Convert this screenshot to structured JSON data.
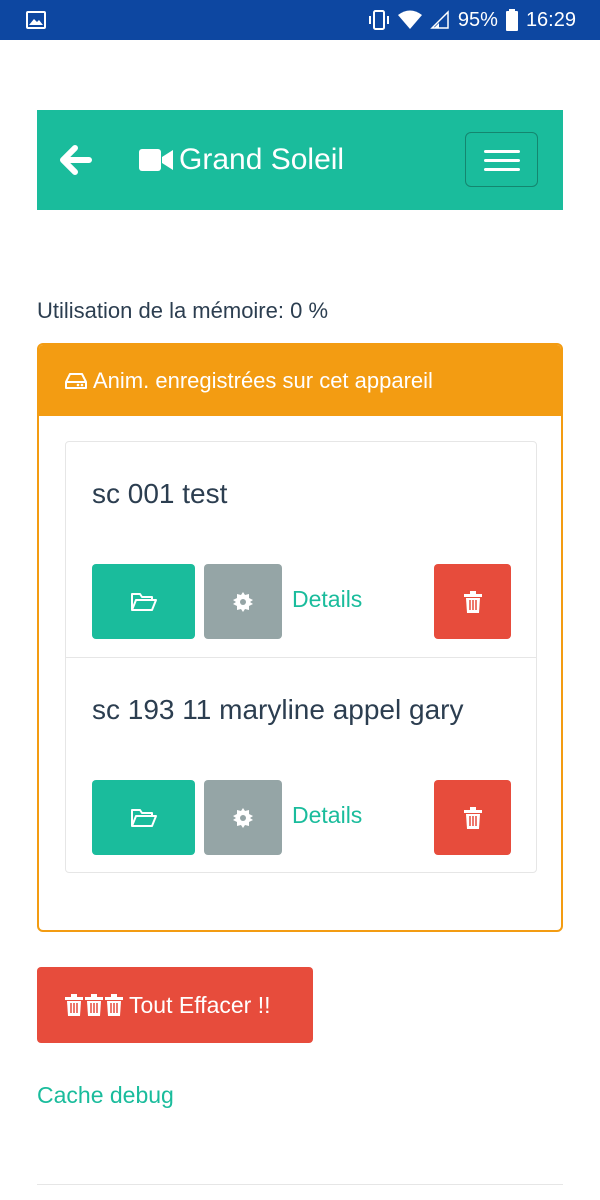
{
  "status_bar": {
    "battery": "95%",
    "time": "16:29"
  },
  "navbar": {
    "title": "Grand Soleil",
    "icons": [
      "back-arrow-icon",
      "video-camera-icon",
      "hamburger-menu-icon"
    ]
  },
  "memory": {
    "label": "Utilisation de la mémoire: 0 %"
  },
  "panel": {
    "heading": "Anim. enregistrées sur cet appareil",
    "items": [
      {
        "title": "sc 001 test",
        "details_label": "Details"
      },
      {
        "title": "sc 193 11 maryline appel gary",
        "details_label": "Details"
      }
    ]
  },
  "actions": {
    "clear_all_label": "Tout Effacer !!",
    "cache_debug_label": "Cache debug"
  },
  "colors": {
    "statusbar": "#0d47a1",
    "primary": "#1abc9c",
    "warning": "#f39c12",
    "danger": "#e74c3c",
    "secondary": "#95a5a6",
    "text": "#2c3e50"
  }
}
